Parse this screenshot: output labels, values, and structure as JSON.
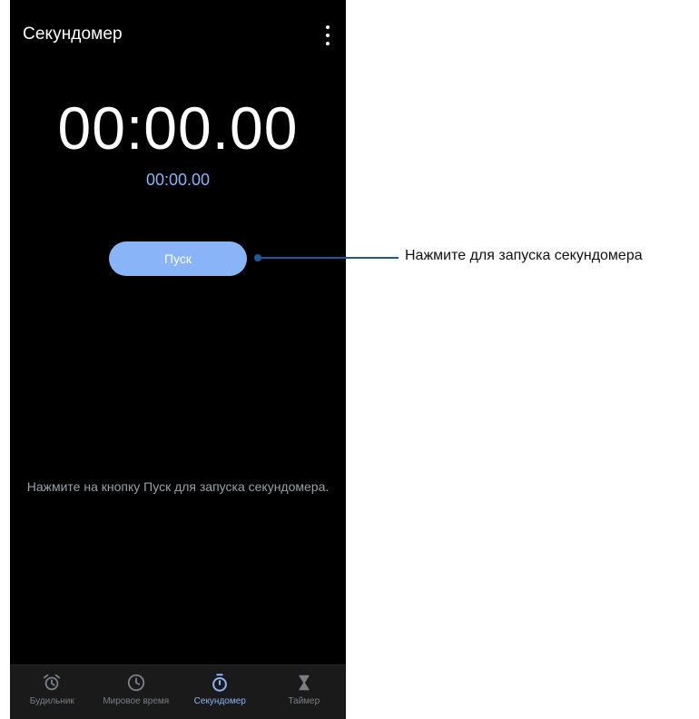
{
  "app": {
    "title": "Секундомер"
  },
  "stopwatch": {
    "main_time": "00:00.00",
    "lap_time": "00:00.00",
    "start_label": "Пуск",
    "hint": "Нажмите на кнопку Пуск для запуска секундомера."
  },
  "nav": {
    "items": [
      {
        "label": "Будильник",
        "icon": "alarm-icon",
        "active": false
      },
      {
        "label": "Мировое время",
        "icon": "clock-icon",
        "active": false
      },
      {
        "label": "Секундомер",
        "icon": "stopwatch-icon",
        "active": true
      },
      {
        "label": "Таймер",
        "icon": "hourglass-icon",
        "active": false
      }
    ]
  },
  "callout": {
    "text": "Нажмите для запуска секундомера"
  },
  "colors": {
    "accent": "#8ab4f8",
    "background": "#000000",
    "callout": "#1b5a99"
  }
}
